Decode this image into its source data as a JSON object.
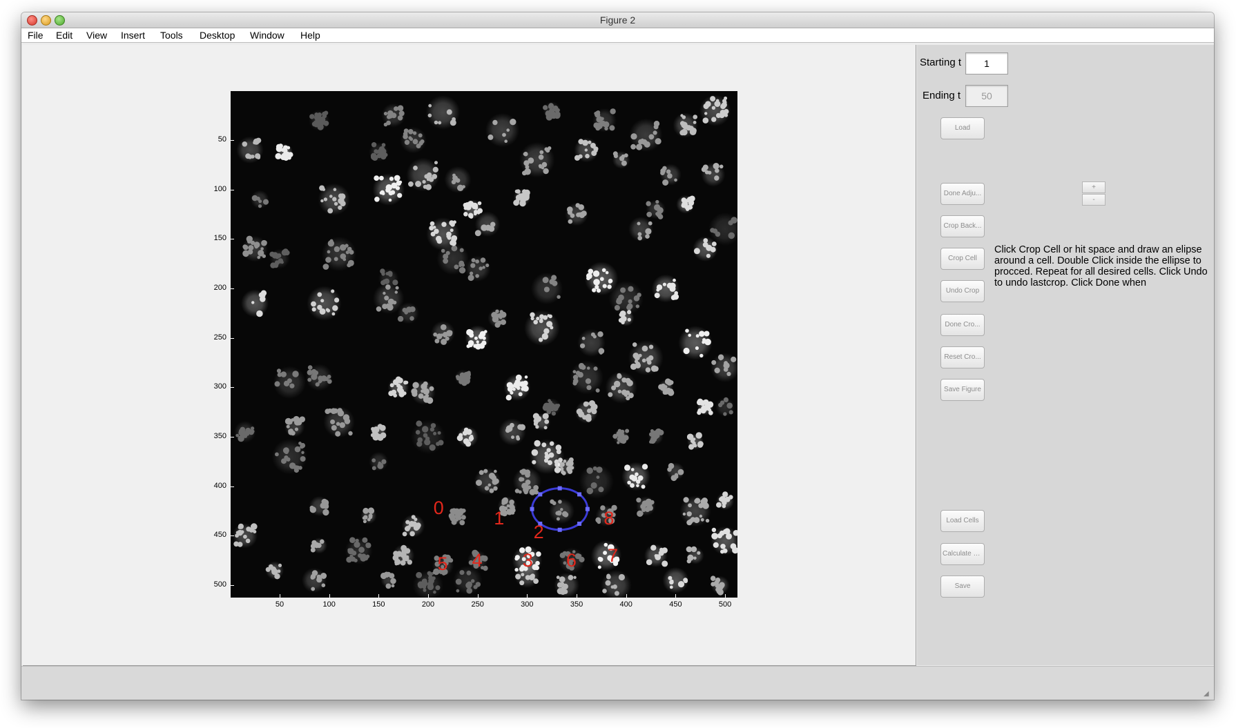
{
  "window": {
    "title": "Figure 2"
  },
  "menu": [
    "File",
    "Edit",
    "View",
    "Insert",
    "Tools",
    "Desktop",
    "Window",
    "Help"
  ],
  "axes": {
    "y_ticks": [
      "50",
      "100",
      "150",
      "200",
      "250",
      "300",
      "350",
      "400",
      "450",
      "500"
    ],
    "x_ticks": [
      "50",
      "100",
      "150",
      "200",
      "250",
      "300",
      "350",
      "400",
      "450",
      "500"
    ],
    "cell_labels": [
      {
        "text": "0",
        "x": 211,
        "y": 422
      },
      {
        "text": "1",
        "x": 272,
        "y": 432
      },
      {
        "text": "2",
        "x": 312,
        "y": 446
      },
      {
        "text": "3",
        "x": 301,
        "y": 475
      },
      {
        "text": "4",
        "x": 250,
        "y": 475
      },
      {
        "text": "5",
        "x": 215,
        "y": 478
      },
      {
        "text": "6",
        "x": 345,
        "y": 475
      },
      {
        "text": "7",
        "x": 387,
        "y": 470
      },
      {
        "text": "8",
        "x": 383,
        "y": 432
      }
    ],
    "selection_ellipse": {
      "cx": 333,
      "cy": 423,
      "rx": 28,
      "ry": 21,
      "color": "#3b3bd6"
    }
  },
  "panel": {
    "starting_label": "Starting t",
    "starting_value": "1",
    "ending_label": "Ending t",
    "ending_value": "50",
    "buttons": {
      "load": "Load",
      "done_adjust": "Done Adju...",
      "crop_background": "Crop Back...",
      "crop_cell": "Crop Cell",
      "undo_crop": "Undo Crop",
      "done_crop": "Done Cro...",
      "reset_crop": "Reset Cro...",
      "save_figure": "Save Figure",
      "load_cells": "Load Cells",
      "calculate_dist": "Calculate Dist",
      "save": "Save"
    },
    "stepper": {
      "plus": "+",
      "minus": "-"
    },
    "instructions": "Click Crop Cell or hit space and draw an elipse around a cell. Double Click inside the ellipse to procced. Repeat for all desired cells. Click Undo to undo lastcrop. Click Done when"
  }
}
